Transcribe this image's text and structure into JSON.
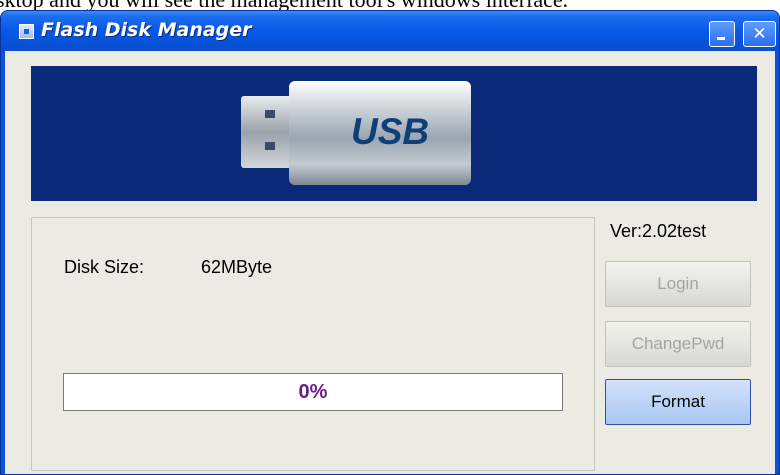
{
  "caption": "sktop and you will see the management tool's windows interface.",
  "window": {
    "title": "Flash Disk Manager",
    "minimize_icon": "minimize-icon",
    "close_icon": "close-icon",
    "close_glyph": "✕"
  },
  "banner": {
    "usb_text": "USB"
  },
  "info": {
    "disk_size_label": "Disk Size:",
    "disk_size_value": "62MByte",
    "progress_text": "0%",
    "progress_fraction": 0
  },
  "sidebar": {
    "version": "Ver:2.02test",
    "buttons": {
      "login": "Login",
      "changepwd": "ChangePwd",
      "format": "Format"
    }
  },
  "colors": {
    "titlebar": "#0a5ae6",
    "banner": "#0a2979",
    "progress_text": "#6a1f8f"
  }
}
